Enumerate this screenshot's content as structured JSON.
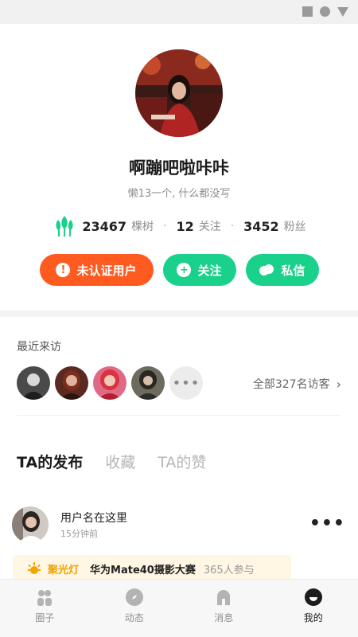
{
  "profile": {
    "name": "啊蹦吧啦咔咔",
    "bio": "懒13一个, 什么都没写"
  },
  "stats": {
    "trees_value": "23467",
    "trees_label": "棵树",
    "following_value": "12",
    "following_label": "关注",
    "followers_value": "3452",
    "followers_label": "粉丝",
    "separator": "·"
  },
  "actions": {
    "unverified_label": "未认证用户",
    "follow_label": "关注",
    "message_label": "私信"
  },
  "visitors": {
    "title": "最近来访",
    "more_glyph": "•••",
    "all_label": "全部327名访客",
    "chevron": "›"
  },
  "tabs": [
    {
      "label": "TA的发布"
    },
    {
      "label": "收藏"
    },
    {
      "label": "TA的赞"
    }
  ],
  "post": {
    "user": "用户名在这里",
    "time": "15分钟前",
    "more_glyph": "•••",
    "banner_tag": "聚光灯",
    "banner_title": "华为Mate40摄影大赛",
    "banner_count": "365人参与"
  },
  "tabbar": {
    "items": [
      {
        "label": "圈子"
      },
      {
        "label": "动态"
      },
      {
        "label": "消息"
      },
      {
        "label": "我的"
      }
    ]
  },
  "colors": {
    "accent_green": "#19d18a",
    "accent_orange": "#ff5a1f",
    "banner_yellow": "#f2a400"
  }
}
